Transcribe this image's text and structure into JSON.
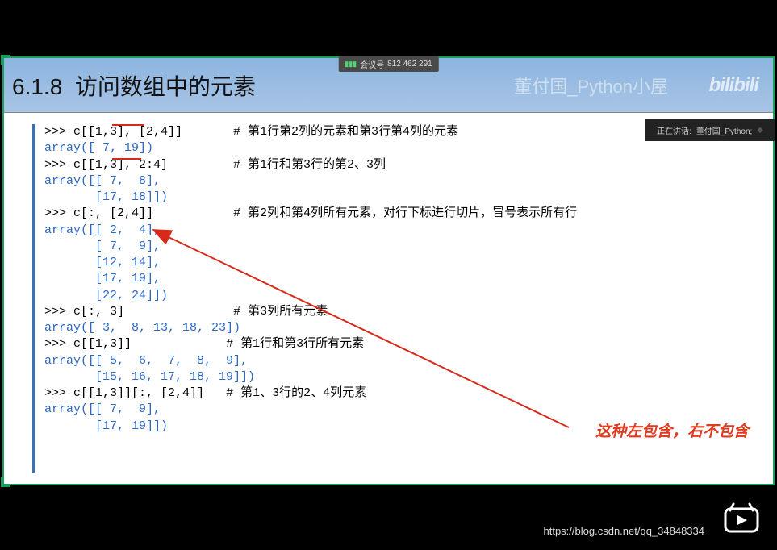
{
  "header": {
    "section_number": "6.1.8",
    "section_title": "访问数组中的元素",
    "author": "董付国_Python小屋",
    "logo": "bilibili"
  },
  "meeting": {
    "label": "会议号",
    "number": "812 462 291"
  },
  "status": {
    "prefix": "正在讲话:",
    "speaker": "董付国_Python;"
  },
  "code": {
    "l1": ">>> c[[1,3], [2,4]]",
    "c1": "# 第1行第2列的元素和第3行第4列的元素",
    "o1": "array([ 7, 19])",
    "l2": ">>> c[[1,3], 2:4]",
    "c2": "# 第1行和第3行的第2、3列",
    "o2": "array([[ 7,  8],\n       [17, 18]])",
    "l3": ">>> c[:, [2,4]]",
    "c3": "# 第2列和第4列所有元素，对行下标进行切片，冒号表示所有行",
    "o3": "array([[ 2,  4],\n       [ 7,  9],\n       [12, 14],\n       [17, 19],\n       [22, 24]])",
    "l4": ">>> c[:, 3]",
    "c4": "# 第3列所有元素",
    "o4": "array([ 3,  8, 13, 18, 23])",
    "l5": ">>> c[[1,3]]",
    "c5": "# 第1行和第3行所有元素",
    "o5": "array([[ 5,  6,  7,  8,  9],\n       [15, 16, 17, 18, 19]])",
    "l6": ">>> c[[1,3]][:, [2,4]]",
    "c6": "# 第1、3行的2、4列元素",
    "o6": "array([[ 7,  9],\n       [17, 19]])"
  },
  "annotation": "这种左包含，右不包含",
  "watermark": "https://blog.csdn.net/qq_34848334"
}
